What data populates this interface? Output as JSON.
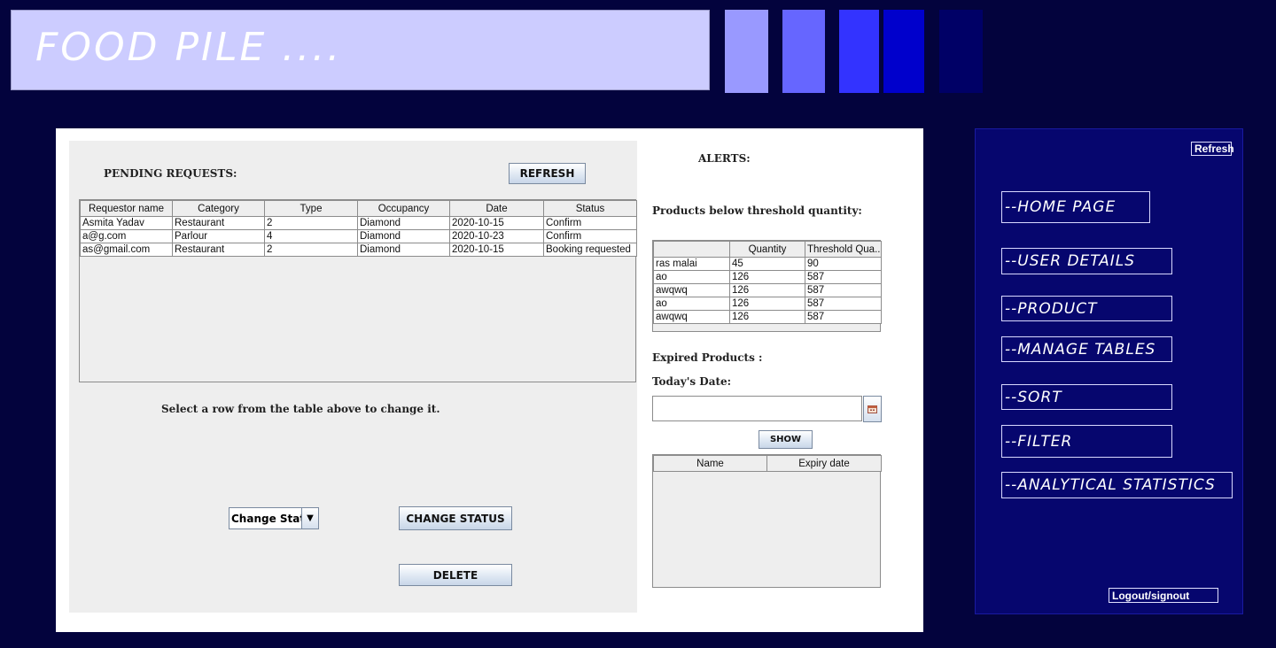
{
  "header": {
    "title": "FOOD PILE ....",
    "swatches": [
      "#9999ff",
      "#6666ff",
      "#3333ff",
      "#0000cc",
      "#000066"
    ]
  },
  "requests": {
    "heading": "PENDING REQUESTS:",
    "refresh_label": "REFRESH",
    "columns": [
      "Requestor name",
      "Category",
      "Type",
      "Occupancy",
      "Date",
      "Status"
    ],
    "rows": [
      [
        "Asmita Yadav",
        "Restaurant",
        "2",
        "Diamond",
        "2020-10-15",
        "Confirm"
      ],
      [
        "a@g.com",
        "Parlour",
        "4",
        "Diamond",
        "2020-10-23",
        "Confirm"
      ],
      [
        "as@gmail.com",
        "Restaurant",
        "2",
        "Diamond",
        "2020-10-15",
        "Booking requested"
      ]
    ],
    "hint": "Select a row from the table above to change it.",
    "status_select": "Change Status",
    "change_status_label": "CHANGE STATUS",
    "delete_label": "DELETE"
  },
  "alerts": {
    "heading": "ALERTS:",
    "threshold_heading": "Products below threshold quantity:",
    "threshold_columns": [
      "",
      "Quantity",
      "Threshold Qua..."
    ],
    "threshold_rows": [
      [
        "ras malai",
        "45",
        "90"
      ],
      [
        "ao",
        "126",
        "587"
      ],
      [
        "awqwq",
        "126",
        "587"
      ],
      [
        "ao",
        "126",
        "587"
      ],
      [
        "awqwq",
        "126",
        "587"
      ]
    ],
    "expired_heading": "Expired Products :",
    "date_label": "Today's Date:",
    "date_value": "",
    "calendar_icon": "calendar-icon",
    "show_label": "SHOW",
    "expired_columns": [
      "Name",
      "Expiry date"
    ]
  },
  "sidebar": {
    "refresh_label": "Refresh",
    "nav": [
      "--HOME PAGE",
      "--USER DETAILS",
      "--PRODUCT",
      "--MANAGE TABLES",
      "--SORT",
      "--FILTER",
      "--ANALYTICAL STATISTICS"
    ],
    "logout_label": "Logout/signout"
  }
}
